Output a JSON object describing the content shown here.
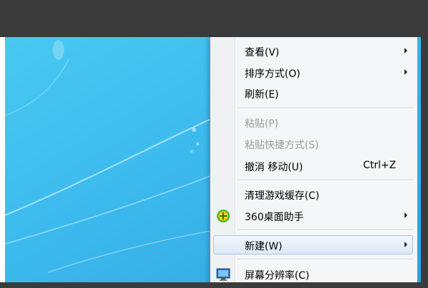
{
  "colors": {
    "frame": "#3b3b3b",
    "desktop_blue": "#3ebcee",
    "menu_bg": "#f5f6f7",
    "disabled_text": "#9b9b9b",
    "highlight_border": "#a9c6e8"
  },
  "context_menu": {
    "items": [
      {
        "label": "查看(V)",
        "has_submenu": true,
        "disabled": false
      },
      {
        "label": "排序方式(O)",
        "has_submenu": true,
        "disabled": false
      },
      {
        "label": "刷新(E)",
        "has_submenu": false,
        "disabled": false
      },
      {
        "label": "粘贴(P)",
        "has_submenu": false,
        "disabled": true
      },
      {
        "label": "粘贴快捷方式(S)",
        "has_submenu": false,
        "disabled": true
      },
      {
        "label": "撤消 移动(U)",
        "shortcut": "Ctrl+Z",
        "has_submenu": false,
        "disabled": false
      },
      {
        "label": "清理游戏缓存(C)",
        "has_submenu": false,
        "disabled": false
      },
      {
        "label": "360桌面助手",
        "icon": "360-assistant-icon",
        "has_submenu": true,
        "disabled": false
      },
      {
        "label": "新建(W)",
        "has_submenu": true,
        "disabled": false,
        "highlighted": true
      },
      {
        "label": "屏幕分辨率(C)",
        "icon": "display-icon",
        "has_submenu": false,
        "disabled": false
      }
    ]
  }
}
